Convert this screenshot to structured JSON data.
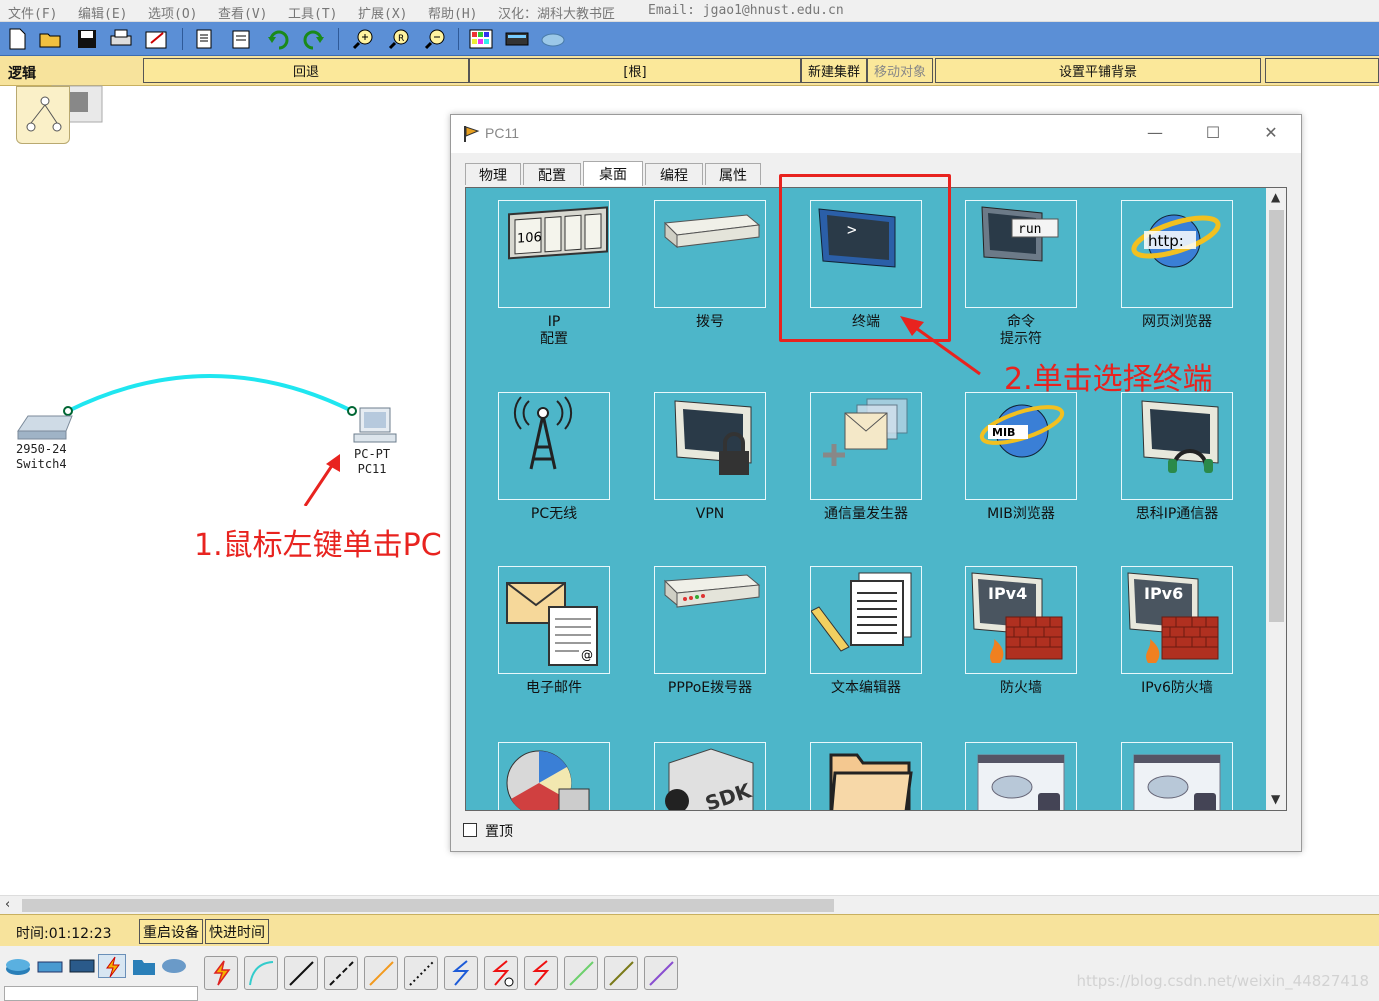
{
  "menu": {
    "items": [
      "文件(F)",
      "编辑(E)",
      "选项(O)",
      "查看(V)",
      "工具(T)",
      "扩展(X)",
      "帮助(H)",
      "汉化：湖科大教书匠",
      "Email: jgao1@hnust.edu.cn"
    ]
  },
  "logicbar": {
    "mode_label": "逻辑",
    "back": "回退",
    "root": "[根]",
    "new_cluster": "新建集群",
    "move_object": "移动对象",
    "set_background": "设置平铺背景"
  },
  "topology": {
    "switch_label": "2950-24\nSwitch4",
    "pc_label": "PC-PT\nPC11",
    "link_color": "#1fe6f0"
  },
  "annotations": {
    "step1": "1.鼠标左键单击PC",
    "step2": "2.单击选择终端",
    "color": "#e8231f"
  },
  "pc_window": {
    "title": "PC11",
    "tabs": [
      "物理",
      "配置",
      "桌面",
      "编程",
      "属性"
    ],
    "active_tab": "桌面",
    "apps": [
      {
        "label": "IP\n配置",
        "icon": "ip-config-icon"
      },
      {
        "label": "拨号",
        "icon": "dialup-icon"
      },
      {
        "label": "终端",
        "icon": "terminal-icon"
      },
      {
        "label": "命令\n提示符",
        "icon": "command-prompt-icon"
      },
      {
        "label": "网页浏览器",
        "icon": "web-browser-icon"
      },
      {
        "label": "PC无线",
        "icon": "pc-wireless-icon"
      },
      {
        "label": "VPN",
        "icon": "vpn-icon"
      },
      {
        "label": "通信量发生器",
        "icon": "traffic-generator-icon"
      },
      {
        "label": "MIB浏览器",
        "icon": "mib-browser-icon"
      },
      {
        "label": "思科IP通信器",
        "icon": "cisco-ip-communicator-icon"
      },
      {
        "label": "电子邮件",
        "icon": "email-icon"
      },
      {
        "label": "PPPoE拨号器",
        "icon": "pppoe-dialer-icon"
      },
      {
        "label": "文本编辑器",
        "icon": "text-editor-icon"
      },
      {
        "label": "防火墙",
        "icon": "firewall-icon"
      },
      {
        "label": "IPv6防火墙",
        "icon": "ipv6-firewall-icon"
      },
      {
        "label": "",
        "icon": "netflow-collector-icon"
      },
      {
        "label": "",
        "icon": "sdk-icon"
      },
      {
        "label": "",
        "icon": "file-manager-icon"
      },
      {
        "label": "",
        "icon": "iot-monitor-icon"
      },
      {
        "label": "",
        "icon": "cloud-app-icon"
      }
    ],
    "icon_text": {
      "ip": "106",
      "run": "run",
      "http": "http:",
      "mib": "MIB",
      "ipv4": "IPv4",
      "ipv6": "IPv6",
      "sdk": "SDK",
      "prompt": ">"
    },
    "always_on_top": "置顶"
  },
  "status": {
    "time": "时间:01:12:23",
    "reset_devices": "重启设备",
    "fast_forward": "快进时间"
  },
  "watermark": "https://blog.csdn.net/weixin_44827418"
}
